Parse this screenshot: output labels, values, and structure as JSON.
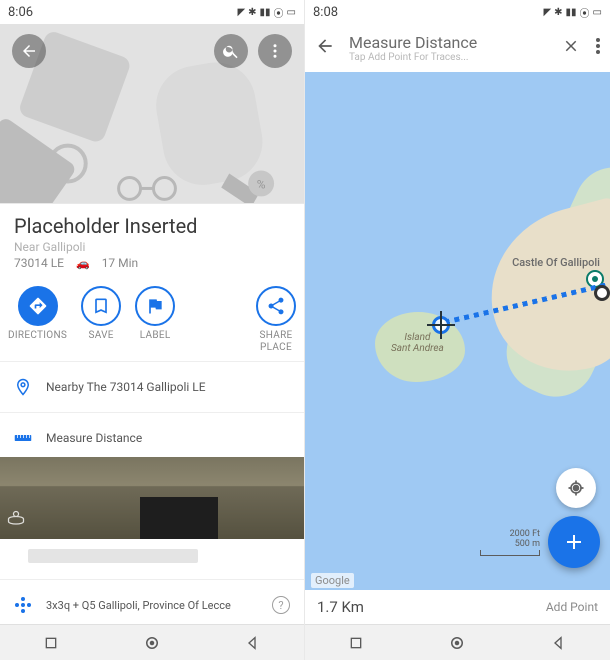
{
  "left": {
    "status": {
      "time": "8:06"
    },
    "place": {
      "title": "Placeholder Inserted",
      "near": "Near Gallipoli",
      "postal": "73014 LE",
      "eta": "17 Min"
    },
    "actions": {
      "directions": "DIRECTIONS",
      "save": "SAVE",
      "label": "LABEL",
      "share": "SHARE",
      "share_sub": "PLACE"
    },
    "nearby": "Nearby The 73014 Gallipoli LE",
    "measure": "Measure Distance",
    "pluscode": "3x3q + Q5 Gallipoli, Province Of Lecce"
  },
  "right": {
    "status": {
      "time": "8:08"
    },
    "title": "Measure Distance",
    "hint": "Tap Add Point For Traces...",
    "labels": {
      "castle": "Castle Of Gallipoli",
      "island_line1": "Island",
      "island_line2": "Sant Andrea",
      "google": "Google"
    },
    "scale": {
      "top": "2000 Ft",
      "bottom": "500 m"
    },
    "distance": "1.7 Km",
    "add_point": "Add Point"
  }
}
